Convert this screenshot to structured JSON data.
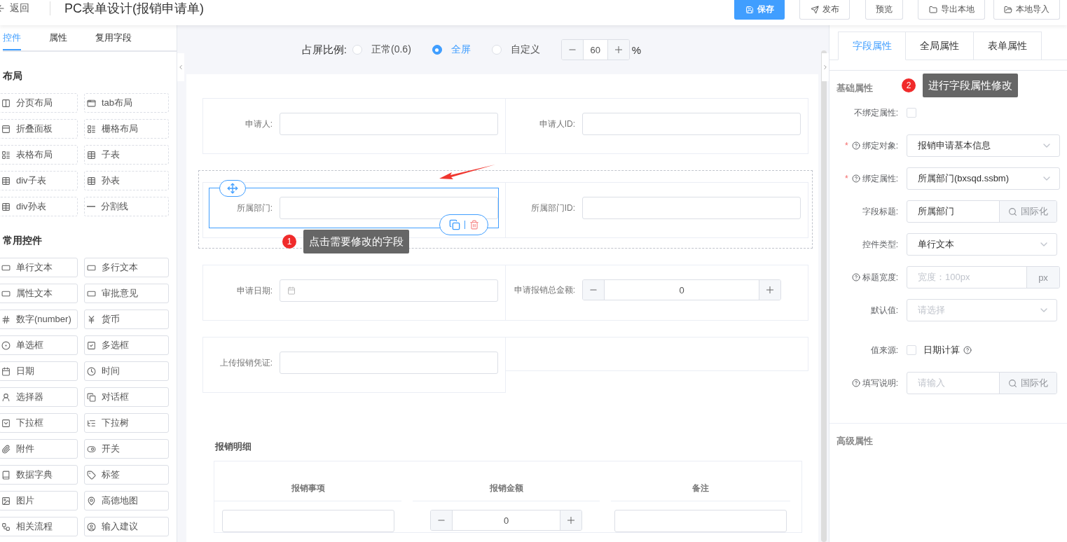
{
  "header": {
    "back_label": "返回",
    "title": "PC表单设计(报销申请单)",
    "buttons": [
      {
        "label": "保存",
        "kind": "primary"
      },
      {
        "label": "发布",
        "kind": "default"
      },
      {
        "label": "预览",
        "kind": "default"
      },
      {
        "label": "导出本地",
        "kind": "default"
      },
      {
        "label": "本地导入",
        "kind": "default"
      }
    ]
  },
  "left_panel": {
    "tabs": [
      {
        "label": "控件",
        "selected": true
      },
      {
        "label": "属性",
        "selected": false
      },
      {
        "label": "复用字段",
        "selected": false
      }
    ],
    "sections": [
      {
        "title": "布局",
        "kind": "layout",
        "items": [
          "分页布局",
          "tab布局",
          "折叠面板",
          "栅格布局",
          "表格布局",
          "子表",
          "div子表",
          "孙表",
          "div孙表",
          "分割线"
        ]
      },
      {
        "title": "常用控件",
        "kind": "common",
        "items": [
          "单行文本",
          "多行文本",
          "属性文本",
          "审批意见",
          "数字(number)",
          "货币",
          "单选框",
          "多选框",
          "日期",
          "时间",
          "选择器",
          "对话框",
          "下拉框",
          "下拉树",
          "附件",
          "开关",
          "数据字典",
          "标签",
          "图片",
          "高德地图",
          "相关流程",
          "输入建议"
        ]
      }
    ]
  },
  "canvas": {
    "ratio": {
      "label": "占屏比例:",
      "options": [
        {
          "label": "正常(0.6)",
          "selected": false
        },
        {
          "label": "全屏",
          "selected": true
        },
        {
          "label": "自定义",
          "selected": false
        }
      ],
      "value": "60",
      "unit": "%"
    },
    "rows": [
      {
        "cells": [
          {
            "label": "申请人:",
            "kind": "text",
            "selected": false
          },
          {
            "label": "申请人ID:",
            "kind": "text",
            "selected": false
          }
        ]
      },
      {
        "cells": [
          {
            "label": "所属部门:",
            "kind": "text",
            "selected": true
          },
          {
            "label": "所属部门ID:",
            "kind": "text",
            "selected": false
          }
        ]
      },
      {
        "cells": [
          {
            "label": "申请日期:",
            "kind": "date",
            "selected": false
          },
          {
            "label": "申请报销总金额:",
            "kind": "number",
            "value": "0",
            "selected": false
          }
        ]
      },
      {
        "cells": [
          {
            "label": "上传报销凭证:",
            "kind": "text",
            "selected": false
          },
          {
            "kind": "empty"
          }
        ]
      }
    ],
    "subtable": {
      "title": "报销明细",
      "columns": [
        "报销事项",
        "报销金额",
        "备注"
      ],
      "cells": [
        {
          "kind": "text"
        },
        {
          "kind": "number",
          "value": "0"
        },
        {
          "kind": "text"
        }
      ]
    }
  },
  "callouts": [
    {
      "number": "1",
      "text": "点击需要修改的字段"
    },
    {
      "number": "2",
      "text": "进行字段属性修改"
    }
  ],
  "right_panel": {
    "tabs": [
      {
        "label": "字段属性",
        "selected": true
      },
      {
        "label": "全局属性",
        "selected": false
      },
      {
        "label": "表单属性",
        "selected": false
      }
    ],
    "section_title": "基础属性",
    "fields": [
      {
        "label": "不绑定属性:",
        "kind": "checkbox",
        "checked": false
      },
      {
        "label": "绑定对象:",
        "required_mark": "*",
        "help": true,
        "kind": "select",
        "value": "报销申请基本信息"
      },
      {
        "label": "绑定属性:",
        "required_mark": "*",
        "help": true,
        "kind": "select",
        "value": "所属部门(bxsqd.ssbm)"
      },
      {
        "label": "字段标题:",
        "kind": "addon",
        "value": "所属部门",
        "addon": "国际化"
      },
      {
        "label": "控件类型:",
        "kind": "select",
        "value": "单行文本"
      },
      {
        "label": "标题宽度:",
        "help": true,
        "kind": "unit",
        "placeholder": "宽度：100px",
        "unit": "px"
      },
      {
        "label": "默认值:",
        "kind": "select",
        "placeholder": "请选择"
      },
      {
        "label": "值来源:",
        "kind": "checkbox",
        "checked": false,
        "option": "日期计算"
      },
      {
        "label": "填写说明:",
        "help": true,
        "kind": "addon",
        "placeholder": "请输入",
        "addon": "国际化"
      }
    ],
    "advanced_title": "高级属性"
  }
}
